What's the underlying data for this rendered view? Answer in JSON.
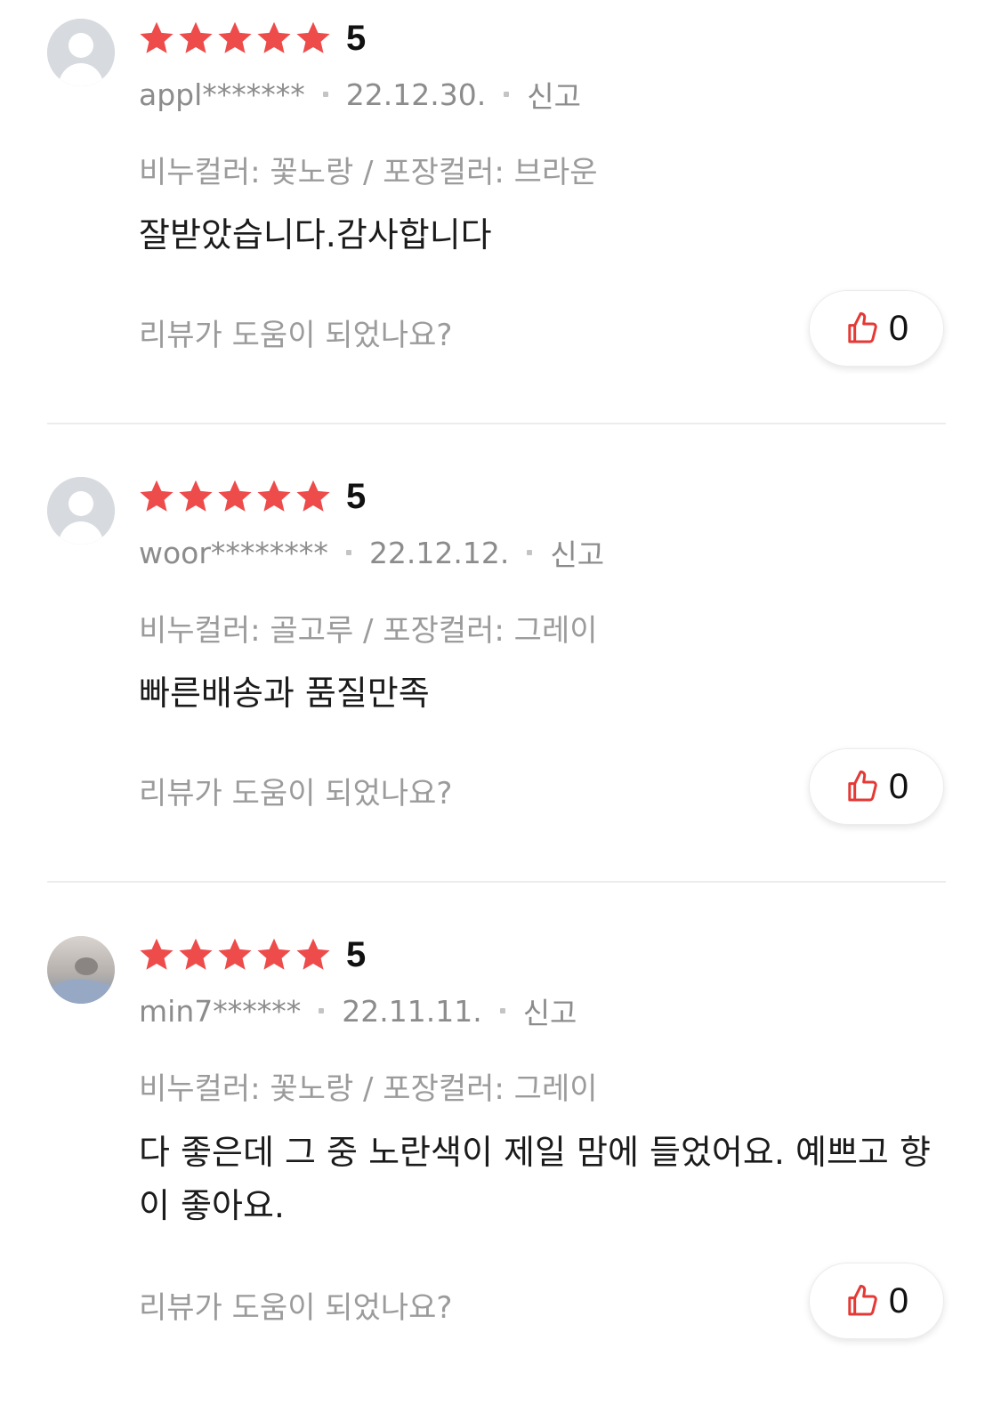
{
  "colors": {
    "star": "#ee4b4b",
    "like_icon": "#e53935",
    "meta_text": "#8c8c8c"
  },
  "reviews": [
    {
      "rating": "5",
      "user": "appl*******",
      "date": "22.12.30.",
      "report_label": "신고",
      "option": "비누컬러: 꽃노랑 / 포장컬러: 브라운",
      "text": "잘받았습니다.감사합니다",
      "helpful_question": "리뷰가 도움이 되었나요?",
      "like_count": "0",
      "avatar": "default-avatar-icon"
    },
    {
      "rating": "5",
      "user": "woor********",
      "date": "22.12.12.",
      "report_label": "신고",
      "option": "비누컬러: 골고루 / 포장컬러: 그레이",
      "text": "빠른배송과 품질만족",
      "helpful_question": "리뷰가 도움이 되었나요?",
      "like_count": "0",
      "avatar": "default-avatar-icon"
    },
    {
      "rating": "5",
      "user": "min7******",
      "date": "22.11.11.",
      "report_label": "신고",
      "option": "비누컬러: 꽃노랑 / 포장컬러: 그레이",
      "text": "다 좋은데 그 중 노란색이 제일 맘에 들었어요. 예쁘고 향이 좋아요.",
      "helpful_question": "리뷰가 도움이 되었나요?",
      "like_count": "0",
      "avatar": "photo-avatar"
    }
  ]
}
